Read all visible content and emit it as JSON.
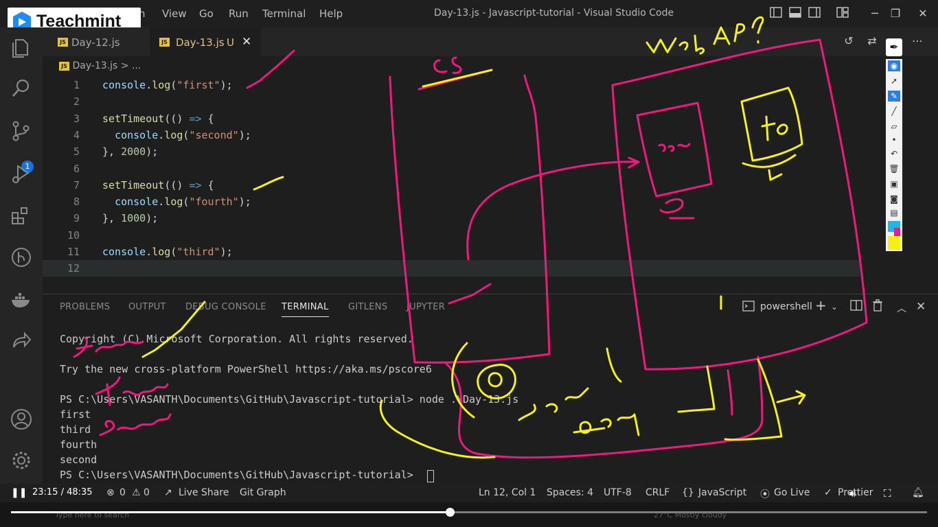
{
  "app": {
    "window_title": "Day-13.js - Javascript-tutorial - Visual Studio Code",
    "menu": [
      "n",
      "View",
      "Go",
      "Run",
      "Terminal",
      "Help"
    ]
  },
  "logo": {
    "text": "Teachmint"
  },
  "activity_bar": {
    "source_control_badge": "1"
  },
  "tabs": [
    {
      "label": "Day-12.js",
      "icon": "JS"
    },
    {
      "label": "Day-13.js",
      "icon": "JS",
      "modified_marker": "U",
      "active": true
    }
  ],
  "breadcrumb": {
    "file": "Day-13.js",
    "rest": "> ..."
  },
  "editor": {
    "lines": [
      {
        "no": "1",
        "text": "console.log(\"first\");"
      },
      {
        "no": "2",
        "text": ""
      },
      {
        "no": "3",
        "text": "setTimeout(() => {"
      },
      {
        "no": "4",
        "text": "  console.log(\"second\");"
      },
      {
        "no": "5",
        "text": "}, 2000);"
      },
      {
        "no": "6",
        "text": ""
      },
      {
        "no": "7",
        "text": "setTimeout(() => {"
      },
      {
        "no": "8",
        "text": "  console.log(\"fourth\");"
      },
      {
        "no": "9",
        "text": "}, 1000);"
      },
      {
        "no": "10",
        "text": ""
      },
      {
        "no": "11",
        "text": "console.log(\"third\");"
      },
      {
        "no": "12",
        "text": ""
      }
    ]
  },
  "panel": {
    "tabs": [
      "PROBLEMS",
      "OUTPUT",
      "DEBUG CONSOLE",
      "TERMINAL",
      "GITLENS",
      "JUPYTER"
    ],
    "active_tab": "TERMINAL",
    "terminal_name": "powershell",
    "terminal_lines": [
      "Copyright (C) Microsoft Corporation. All rights reserved.",
      "",
      "Try the new cross-platform PowerShell https://aka.ms/pscore6",
      "",
      "PS C:\\Users\\VASANTH\\Documents\\GitHub\\Javascript-tutorial> node .\\Day-13.js",
      "first",
      "third",
      "fourth",
      "second",
      "PS C:\\Users\\VASANTH\\Documents\\GitHub\\Javascript-tutorial> "
    ]
  },
  "status_bar": {
    "errors": "0",
    "warnings": "0",
    "live_share": "Live Share",
    "git_graph": "Git Graph",
    "position": "Ln 12, Col 1",
    "spaces": "Spaces: 4",
    "encoding": "UTF-8",
    "eol": "CRLF",
    "language": "JavaScript",
    "go_live": "Go Live",
    "prettier": "Prettier"
  },
  "video": {
    "time": "23:15 / 48:35",
    "progress": 0.479
  },
  "taskbar": {
    "search_placeholder": "Type here to search",
    "weather": "27°C  Mostly cloudy"
  },
  "annotations": {
    "ink_colors": {
      "pink": "#f0197d",
      "yellow": "#f4f11b"
    },
    "labels": [
      "CS",
      "Web API",
      "seco",
      "fo",
      "first",
      "third",
      "second",
      "fourth",
      "second"
    ]
  },
  "colors": {
    "accent": "#007acc",
    "js_badge": "#e5c33d"
  }
}
